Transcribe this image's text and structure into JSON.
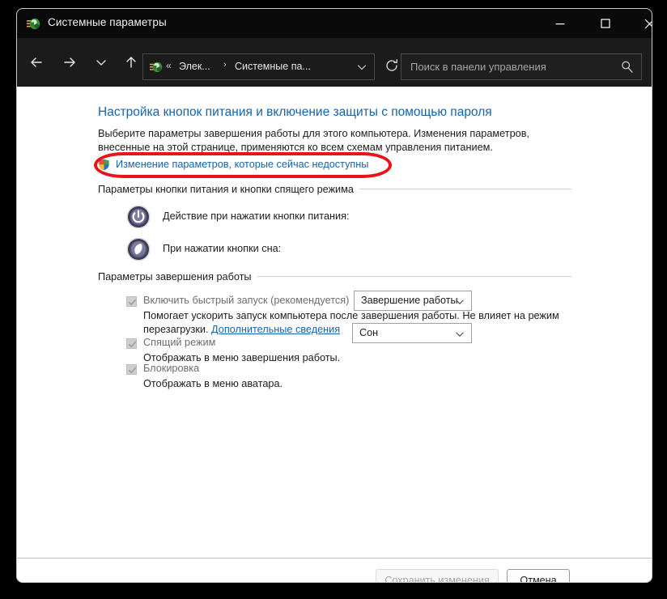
{
  "window": {
    "title": "Системные параметры",
    "icon": "system-properties-icon",
    "controls": {
      "minimize": "minimize-icon",
      "maximize": "maximize-icon",
      "close": "close-icon"
    }
  },
  "navbar": {
    "back": "back-arrow-icon",
    "forward": "forward-arrow-icon",
    "recent": "recent-locations-chevron-icon",
    "up": "up-arrow-icon",
    "address": {
      "icon": "system-properties-icon",
      "overflow": "«",
      "crumb1": "Элек...",
      "separator": "›",
      "crumb2": "Системные па...",
      "dropdown": "chevron-down-icon"
    },
    "refresh": "refresh-icon",
    "search": {
      "placeholder": "Поиск в панели управления",
      "value": "",
      "icon": "search-icon"
    }
  },
  "content": {
    "page_title": "Настройка кнопок питания и включение защиты с помощью пароля",
    "page_description": "Выберите параметры завершения работы для этого компьютера. Изменения параметров, внесенные на этой странице, применяются ко всем схемам управления питанием.",
    "uac_link": "Изменение параметров, которые сейчас недоступны",
    "uac_icon": "uac-shield-icon",
    "highlight_color": "#e8141c",
    "group1": {
      "title": "Параметры кнопки питания и кнопки спящего режима",
      "rows": [
        {
          "icon": "power-button-icon",
          "label": "Действие при нажатии кнопки питания:",
          "value": "Завершение работы",
          "arrow": "chevron-down-icon"
        },
        {
          "icon": "sleep-moon-icon",
          "label": "При нажатии кнопки сна:",
          "value": "Сон",
          "arrow": "chevron-down-icon"
        }
      ]
    },
    "group2": {
      "title": "Параметры завершения работы",
      "items": [
        {
          "label": "Включить быстрый запуск (рекомендуется)",
          "checked": true,
          "enabled": false,
          "description_before": "Помогает ускорить запуск компьютера после завершения работы. Не влияет на режим перезагрузки. ",
          "description_link": "Дополнительные сведения",
          "description_after": ""
        },
        {
          "label": "Спящий режим",
          "checked": true,
          "enabled": false,
          "description_before": "Отображать в меню завершения работы.",
          "description_link": "",
          "description_after": ""
        },
        {
          "label": "Блокировка",
          "checked": true,
          "enabled": false,
          "description_before": "Отображать в меню аватара.",
          "description_link": "",
          "description_after": ""
        }
      ]
    }
  },
  "footer": {
    "save_label": "Сохранить изменения",
    "save_enabled": false,
    "cancel_label": "Отмена"
  }
}
